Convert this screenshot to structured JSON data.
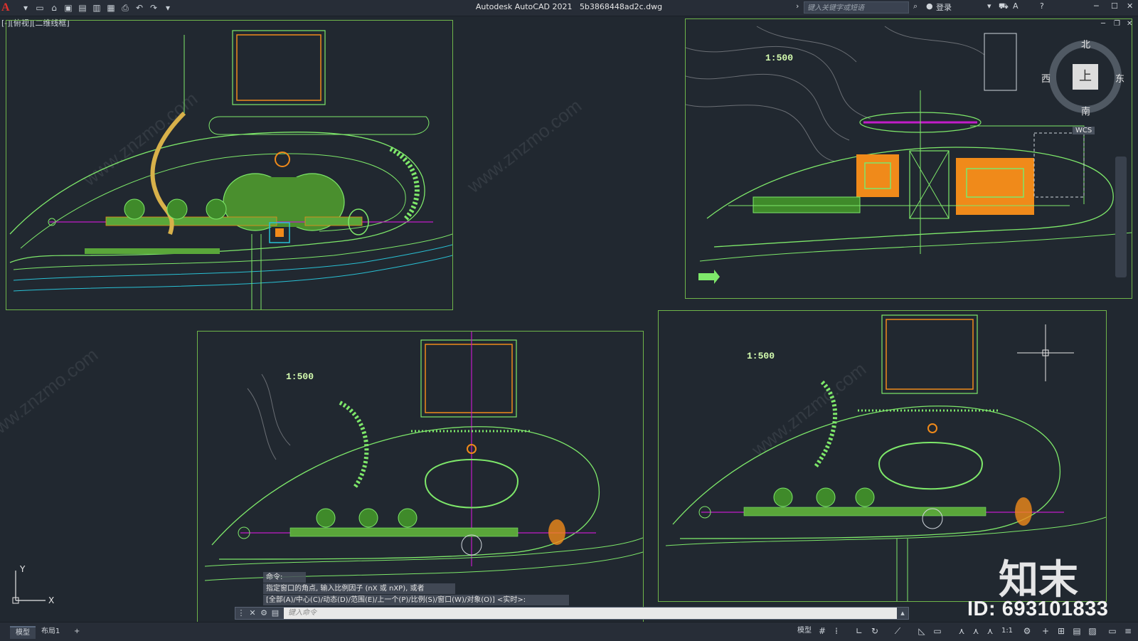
{
  "app": {
    "title": "Autodesk AutoCAD 2021",
    "filename": "5b3868448ad2c.dwg",
    "logo_letter": "A"
  },
  "toolbar": {
    "quick_access_icons": [
      "new-icon",
      "open-icon",
      "save-icon",
      "saveas-icon",
      "plot-preview-icon",
      "publish-icon",
      "print-icon",
      "undo-icon",
      "redo-icon",
      "customize-icon"
    ],
    "search_placeholder": "键入关键字或短语",
    "login_label": "登录"
  },
  "viewport_label": "[-][俯视][二维线框]",
  "drawings": {
    "scale_label": "1:500"
  },
  "viewcube": {
    "top": "上",
    "north": "北",
    "south": "南",
    "east": "东",
    "west": "西",
    "wcs": "WCS"
  },
  "ucs": {
    "x": "X",
    "y": "Y"
  },
  "command": {
    "history": [
      "命令:",
      "指定窗口的角点, 输入比例因子 (nX 或 nXP), 或者",
      "[全部(A)/中心(C)/动态(D)/范围(E)/上一个(P)/比例(S)/窗口(W)/对象(O)] <实时>:"
    ],
    "placeholder": "键入命令"
  },
  "layout_tabs": [
    "模型",
    "布局1"
  ],
  "add_tab": "+",
  "status": {
    "model_label": "模型",
    "scale": "1:1"
  },
  "watermark": {
    "logo_text": "知末",
    "id_text": "ID: 693101833",
    "diag_text": "www.znzmo.com"
  },
  "colors": {
    "background": "#212830",
    "frame": "#6fb54a",
    "green": "#7ee86a",
    "orange": "#f08a1a",
    "magenta": "#c21cc9"
  }
}
